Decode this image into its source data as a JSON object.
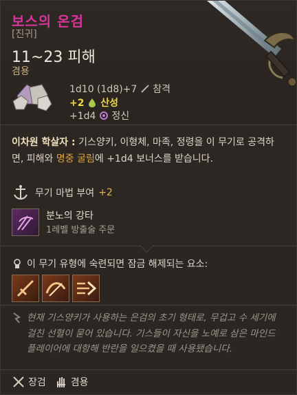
{
  "item": {
    "name": "보스의 온검",
    "rarity": "[진귀]",
    "damage": "11~23 피해",
    "handedness": "겸용",
    "damage_detail": "1d10 (1d8)+7",
    "damage_type": "참격",
    "bonus_acid": "+2",
    "bonus_acid_label": "산성",
    "bonus_psychic": "+1d4",
    "bonus_psychic_label": "정신"
  },
  "passive": {
    "title": "이차원 학살자 :",
    "text_a": " 기스양키, 이형체, 마족, 정령을 이 무기로 공격하면, 피해와 ",
    "highlight": "명중 굴림",
    "text_b": "에 +1d4 보너스를 받습니다."
  },
  "enchant": {
    "label": "무기 마법 부여",
    "value": "+2"
  },
  "spell": {
    "name": "분노의 강타",
    "sub": "1레벨 방출술 주문"
  },
  "unlock": {
    "label": "이 무기 유형에 숙련되면 잠금 해제되는 요소:"
  },
  "actions": [
    "action-1",
    "action-2",
    "action-3"
  ],
  "lore": "현재 기스양키가 사용하는 은검의 초기 형태로, 무겁고 수 세기에 걸친 선혈이 묻어 있습니다. 기스들이 자신을 노예로 삼은 마인드 플레이어에 대항해 반란을 일으켰을 때 사용됐습니다.",
  "proficiency": {
    "type": "장검",
    "hand": "겸용"
  },
  "colors": {
    "title": "#d6359a",
    "accent": "#dba53a",
    "bonus": "#f0d64a"
  },
  "icons": [
    "sword-image",
    "dice-icon",
    "slash-icon",
    "acid-icon",
    "psychic-icon",
    "enchant-icon",
    "lock-icon",
    "lore-icon",
    "swords-icon",
    "hand-icon"
  ]
}
